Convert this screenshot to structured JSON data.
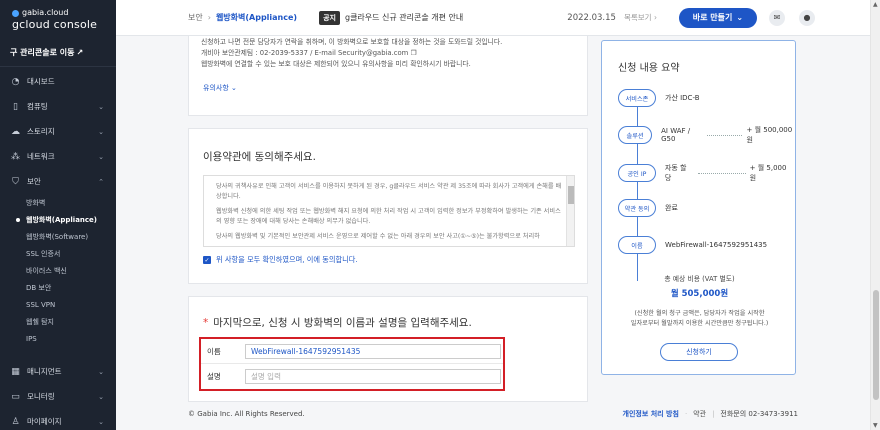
{
  "logo": {
    "line1": "gabia.cloud",
    "line2": "gcloud console"
  },
  "sidebar": {
    "old_console": "구 관리콘솔로 이동",
    "items": [
      {
        "label": "대시보드",
        "has_chevron": false
      },
      {
        "label": "컴퓨팅",
        "has_chevron": true
      },
      {
        "label": "스토리지",
        "has_chevron": true
      },
      {
        "label": "네트워크",
        "has_chevron": true
      },
      {
        "label": "보안",
        "has_chevron": true
      },
      {
        "label": "매니지먼트",
        "has_chevron": true
      },
      {
        "label": "모니터링",
        "has_chevron": true
      },
      {
        "label": "마이페이지",
        "has_chevron": true
      }
    ],
    "security_sub": [
      "방화벽",
      "웹방화벽(Appliance)",
      "웹방화벽(Software)",
      "SSL 인증서",
      "바이러스 백신",
      "DB 보안",
      "SSL VPN",
      "웹쉘 탐지",
      "IPS"
    ],
    "active_sub": "웹방화벽(Appliance)"
  },
  "topbar": {
    "breadcrumb_root": "보안",
    "breadcrumb_current": "웹방화벽(Appliance)",
    "notice_badge": "공지",
    "notice_text": "g클라우드 신규 관리콘솔 개편 안내",
    "notice_date": "2022.03.15",
    "notice_list": "목록보기",
    "build_button": "바로 만들기"
  },
  "notice_card": {
    "line1": "신청하고 나면 전문 담당자가 연락을 취하며, 이 방화벽으로 보호할 대상을 정하는 것을 도와드릴 것입니다.",
    "line2": "개비아 보안관제팀 : 02-2039-5337 / E-mail Security@gabia.com",
    "line3": "웹방화벽에 연결할 수 있는 보호 대상은 제한되어 있으니 유의사항을 미리 확인하시기 바랍니다.",
    "cautions_link": "유의사항"
  },
  "terms_card": {
    "title": "이용약관에 동의해주세요.",
    "para1": "당사의 귀책사유로 인해 고객이 서비스를 이용하지 못하게 된 경우, g클라우드 서비스 약관 제 35조에 따라 회사가 고객에게 손해를 배상합니다.",
    "para2": "웹방화벽 신청에 의한 세팅 작업 또는 웹방화벽 해지 요청에 의한 처리 작업 시 고객이 입력한 정보가 부정확하여 발생하는 기존 서비스의 영향 또는 장애에 대해 당사는 손해배상 의무가 없습니다.",
    "para3": "당사의 웹방화벽 및 기본적인 보안관제 서비스 운영으로 제어할 수 없는 아래 경우의 보안 사고(①~⑤)는 불가항력으로 처리하",
    "agree_label": "위 사항을 모두 확인하였으며, 이에 동의합니다."
  },
  "name_card": {
    "required_mark": "*",
    "title": "마지막으로, 신청 시 방화벽의 이름과 설명을 입력해주세요.",
    "name_label": "이름",
    "name_value": "WebFirewall-1647592951435",
    "desc_label": "설명",
    "desc_placeholder": "설명 입력"
  },
  "summary": {
    "title": "신청 내용 요약",
    "rows": [
      {
        "pill": "서비스존",
        "value": "가산 IDC-B",
        "price": ""
      },
      {
        "pill": "솔루션",
        "value": "AI WAF / G50",
        "price": "+ 월 500,000 원"
      },
      {
        "pill": "공인 IP",
        "value": "자동 할당",
        "price": "+ 월 5,000 원"
      },
      {
        "pill": "약관 동의",
        "value": "완료",
        "price": ""
      },
      {
        "pill": "이름",
        "value": "WebFirewall-1647592951435",
        "price": ""
      }
    ],
    "total_label": "총 예상 비용 (VAT 별도)",
    "total_price": "월 505,000원",
    "note_line1": "(신청한 월의 청구 금액은, 담당자가 작업을 시작한",
    "note_line2": "일자로부터 월말까지 이용한 시간만큼만 청구됩니다.)",
    "apply_button": "신청하기"
  },
  "footer": {
    "copyright": "© Gabia Inc. All Rights Reserved.",
    "privacy": "개인정보 처리 방침",
    "terms": "약관",
    "phone": "전화문의 02-3473-3911"
  },
  "colors": {
    "accent": "#1e56c6",
    "sidebar_bg": "#1d2430",
    "highlight_border": "#d31f26"
  }
}
